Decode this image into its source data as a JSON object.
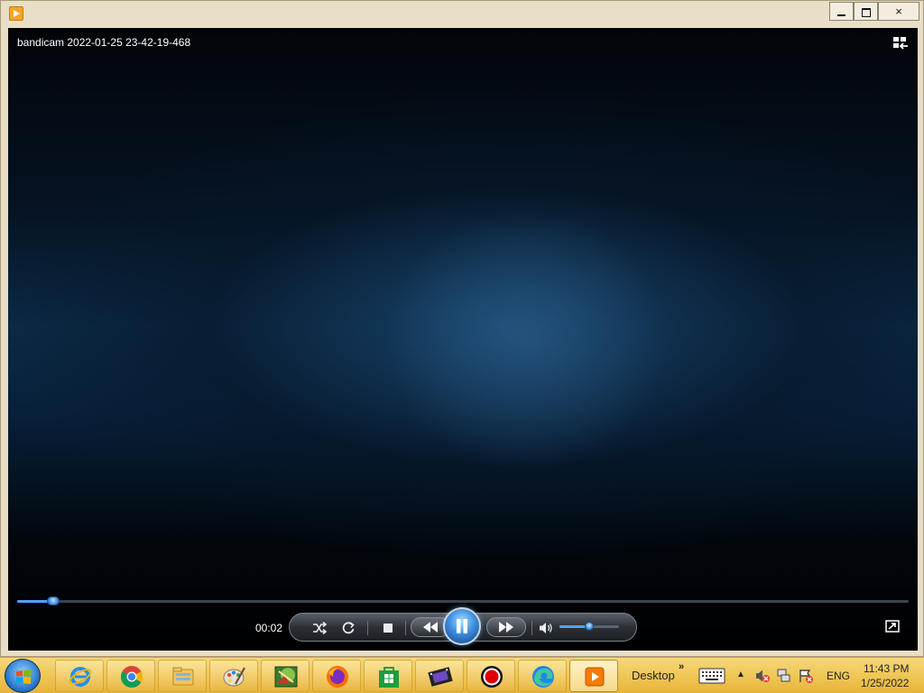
{
  "window": {
    "title_icon": "media-player-icon",
    "buttons": {
      "minimize": "minimize",
      "maximize": "maximize",
      "close": "×"
    }
  },
  "player": {
    "file_title": "bandicam 2022-01-25 23-42-19-468",
    "elapsed": "00:02",
    "seek_progress": 0.04,
    "volume_level": 0.5,
    "state": "playing",
    "accent_color": "#4aa3ff",
    "icons": [
      "switch-to-library-icon",
      "shuffle-icon",
      "repeat-icon",
      "stop-icon",
      "previous-icon",
      "pause-icon",
      "next-icon",
      "volume-icon",
      "fullscreen-icon"
    ]
  },
  "taskbar": {
    "items": [
      {
        "name": "internet-explorer",
        "icon": "ie-icon"
      },
      {
        "name": "chrome",
        "icon": "chrome-icon"
      },
      {
        "name": "file-explorer",
        "icon": "folder-icon"
      },
      {
        "name": "paint",
        "icon": "palette-icon"
      },
      {
        "name": "image-app",
        "icon": "photo-icon"
      },
      {
        "name": "firefox",
        "icon": "firefox-icon"
      },
      {
        "name": "store",
        "icon": "store-icon"
      },
      {
        "name": "movie-maker",
        "icon": "film-icon"
      },
      {
        "name": "bandicam",
        "icon": "record-icon"
      },
      {
        "name": "edge",
        "icon": "edge-icon"
      },
      {
        "name": "media-player",
        "icon": "media-player-icon",
        "active": true
      }
    ],
    "desktop_label": "Desktop",
    "chevron": "»",
    "tray_up": "▲",
    "language": "ENG",
    "clock_time": "11:43 PM",
    "clock_date": "1/25/2022"
  }
}
